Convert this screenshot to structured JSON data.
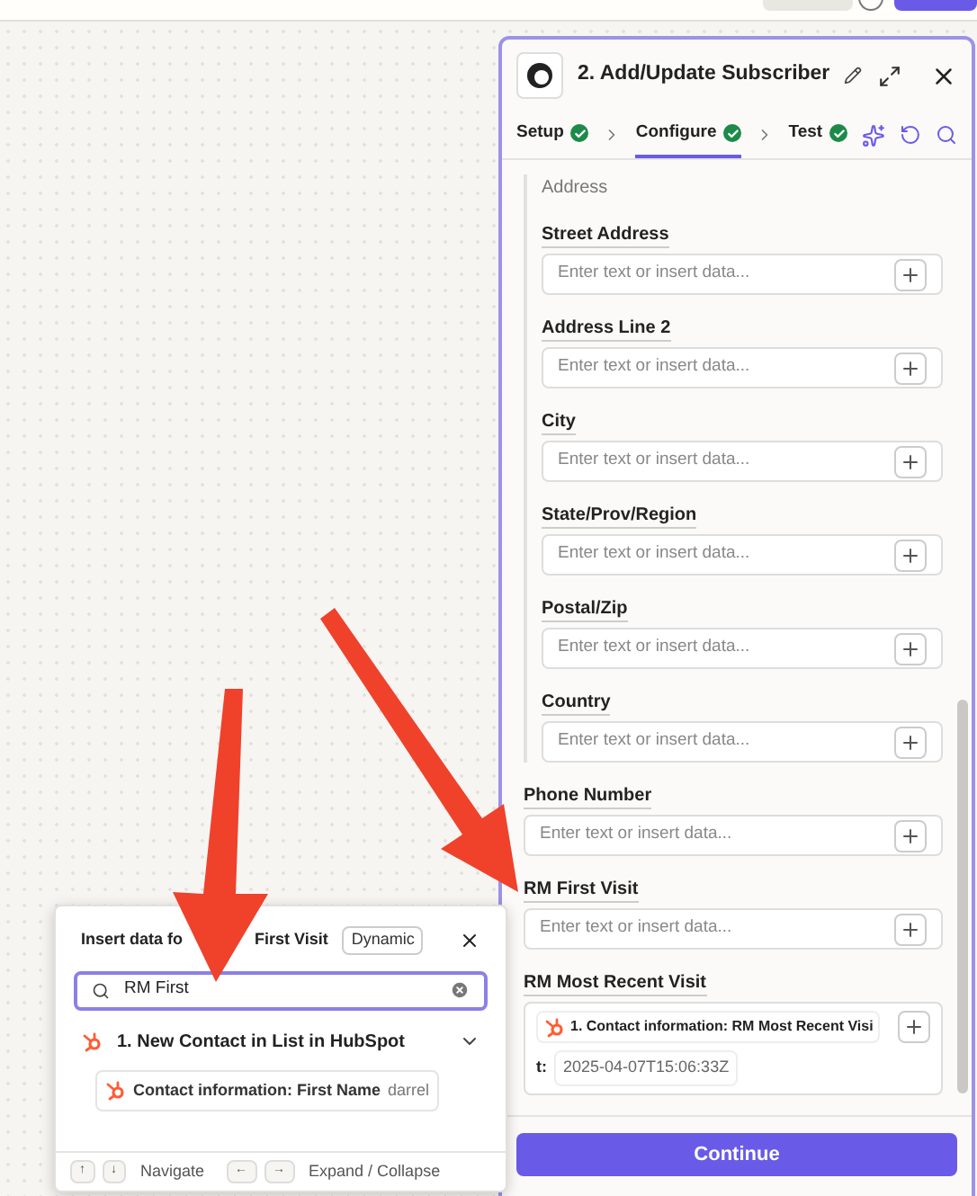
{
  "panel": {
    "title": "2. Add/Update Subscriber",
    "tabs": [
      {
        "label": "Setup",
        "done": true,
        "selected": false
      },
      {
        "label": "Configure",
        "done": true,
        "selected": true
      },
      {
        "label": "Test",
        "done": true,
        "selected": false
      }
    ],
    "address_group": {
      "label": "Address",
      "fields": [
        {
          "label": "Street Address",
          "placeholder": "Enter text or insert data..."
        },
        {
          "label": "Address Line 2",
          "placeholder": "Enter text or insert data..."
        },
        {
          "label": "City",
          "placeholder": "Enter text or insert data..."
        },
        {
          "label": "State/Prov/Region",
          "placeholder": "Enter text or insert data..."
        },
        {
          "label": "Postal/Zip",
          "placeholder": "Enter text or insert data..."
        },
        {
          "label": "Country",
          "placeholder": "Enter text or insert data..."
        }
      ]
    },
    "fields": [
      {
        "label": "Phone Number",
        "placeholder": "Enter text or insert data..."
      },
      {
        "label": "RM First Visit",
        "placeholder": "Enter text or insert data..."
      },
      {
        "label": "RM Most Recent Visit",
        "pill": "1. Contact information: RM Most Recent Visi",
        "pill_rest": "t:",
        "value": "2025-04-07T15:06:33Z"
      }
    ],
    "continue": "Continue"
  },
  "popup": {
    "title_parts": [
      "Insert data fo",
      "First Visit"
    ],
    "badge": "Dynamic",
    "search": "RM First",
    "group": {
      "title": "1.  New Contact in List in HubSpot",
      "expanded": true,
      "items": [
        {
          "label": "Contact information: First Name",
          "value": "darrel"
        }
      ]
    },
    "hints": [
      {
        "keys": [
          "↑",
          "↓"
        ],
        "label": "Navigate"
      },
      {
        "keys": [
          "←",
          "→"
        ],
        "label": "Expand / Collapse"
      }
    ]
  }
}
